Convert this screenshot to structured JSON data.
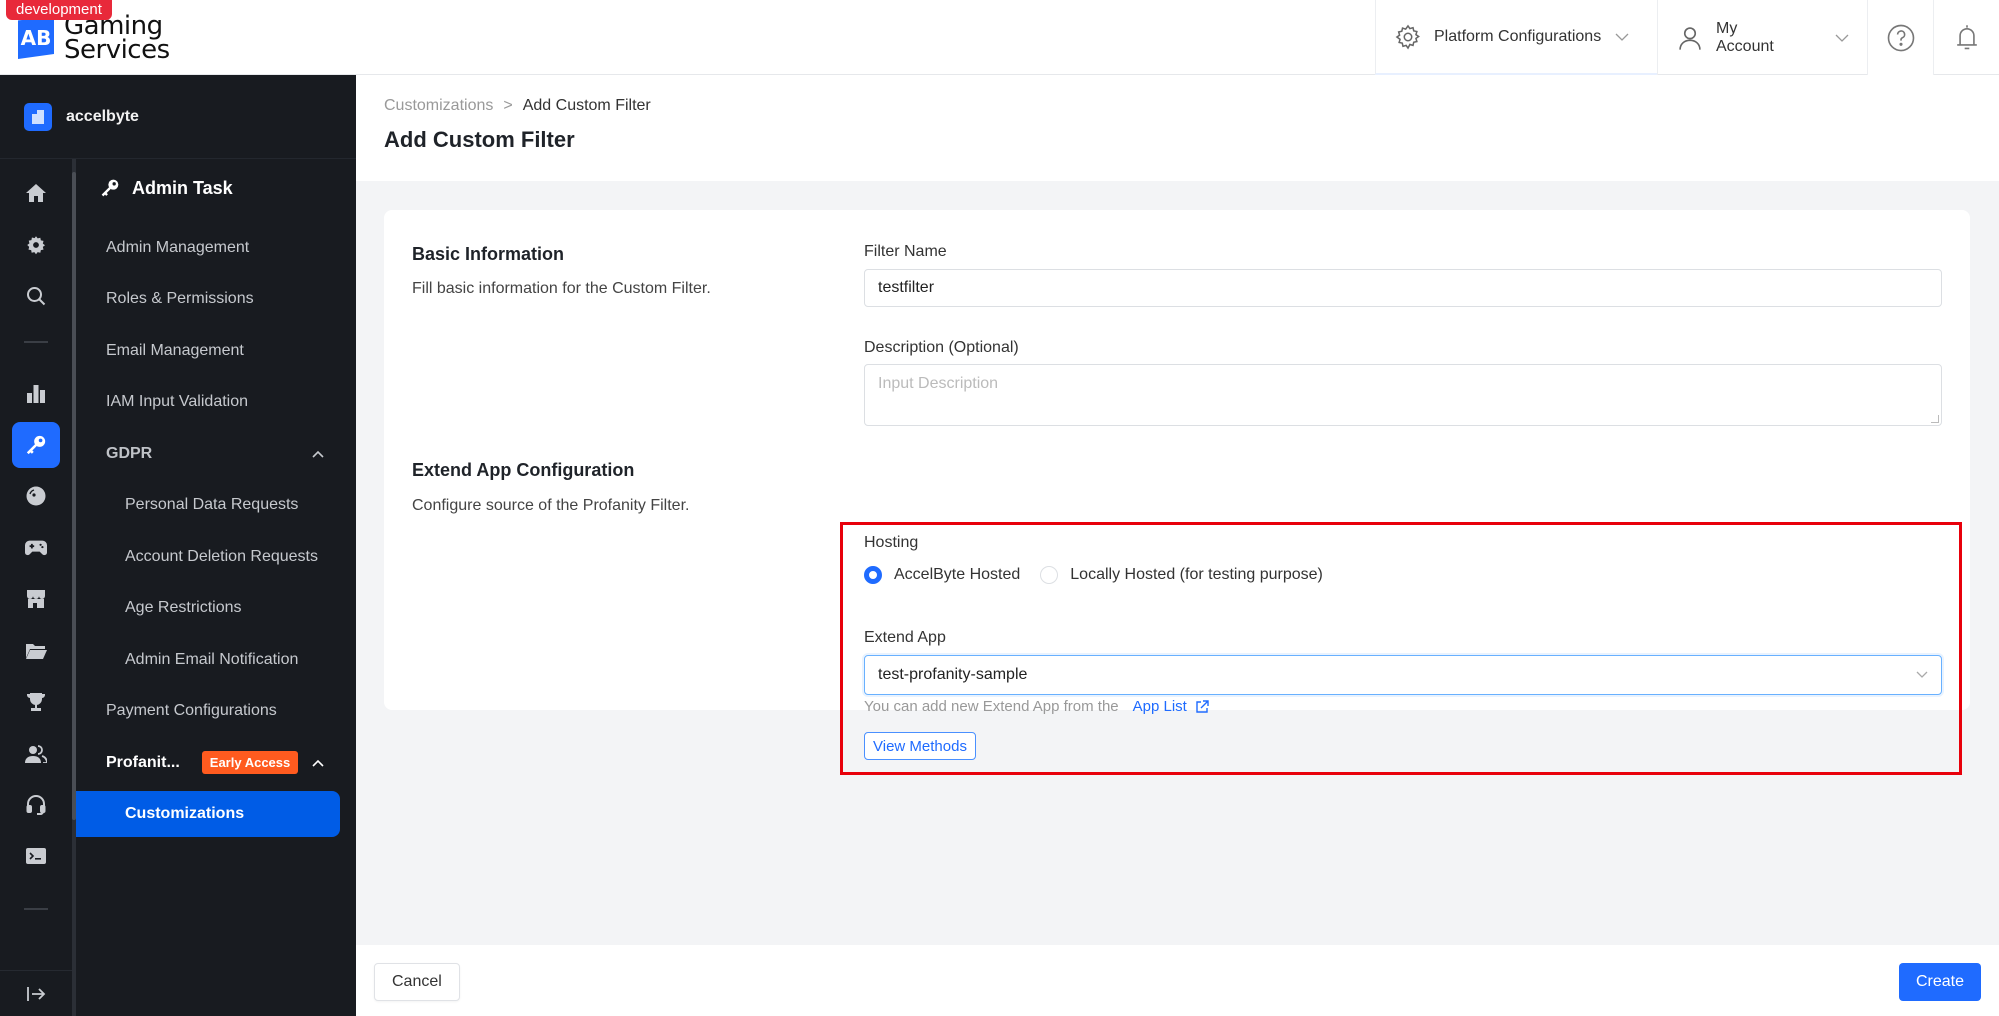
{
  "env_badge": "development",
  "logo": {
    "mark": "AB",
    "line1": "Gaming",
    "line2": "Services"
  },
  "topbar": {
    "platform_configurations": "Platform Configurations",
    "my_account": "My Account"
  },
  "org": {
    "name": "accelbyte"
  },
  "nav": {
    "section_title": "Admin Task",
    "items": [
      {
        "label": "Admin Management"
      },
      {
        "label": "Roles & Permissions"
      },
      {
        "label": "Email Management"
      },
      {
        "label": "IAM Input Validation"
      },
      {
        "label": "GDPR"
      },
      {
        "label": "Personal Data Requests"
      },
      {
        "label": "Account Deletion Requests"
      },
      {
        "label": "Age Restrictions"
      },
      {
        "label": "Admin Email Notification"
      },
      {
        "label": "Payment Configurations"
      },
      {
        "label": "Profanit...",
        "badge": "Early Access"
      },
      {
        "label": "Customizations"
      }
    ]
  },
  "breadcrumb": {
    "parent": "Customizations",
    "separator": ">",
    "current": "Add Custom Filter"
  },
  "page_title": "Add Custom Filter",
  "basic_info": {
    "title": "Basic Information",
    "description": "Fill basic information for the Custom Filter.",
    "filter_name_label": "Filter Name",
    "filter_name_value": "testfilter",
    "description_label": "Description (Optional)",
    "description_placeholder": "Input Description"
  },
  "extend_config": {
    "title": "Extend App Configuration",
    "description": "Configure source of the Profanity Filter.",
    "hosting_label": "Hosting",
    "hosting_options": [
      {
        "label": "AccelByte Hosted",
        "checked": true
      },
      {
        "label": "Locally Hosted (for testing purpose)",
        "checked": false
      }
    ],
    "extend_app_label": "Extend App",
    "extend_app_value": "test-profanity-sample",
    "helper_text": "You can add new Extend App from the",
    "app_list_link": "App List",
    "view_methods_button": "View Methods"
  },
  "footer": {
    "cancel": "Cancel",
    "create": "Create"
  },
  "colors": {
    "primary": "#1f6bff",
    "sidebar_bg": "#181b20",
    "highlight": "#e8000b",
    "early_access": "#ff5b1f",
    "env_badge": "#e8293a"
  }
}
